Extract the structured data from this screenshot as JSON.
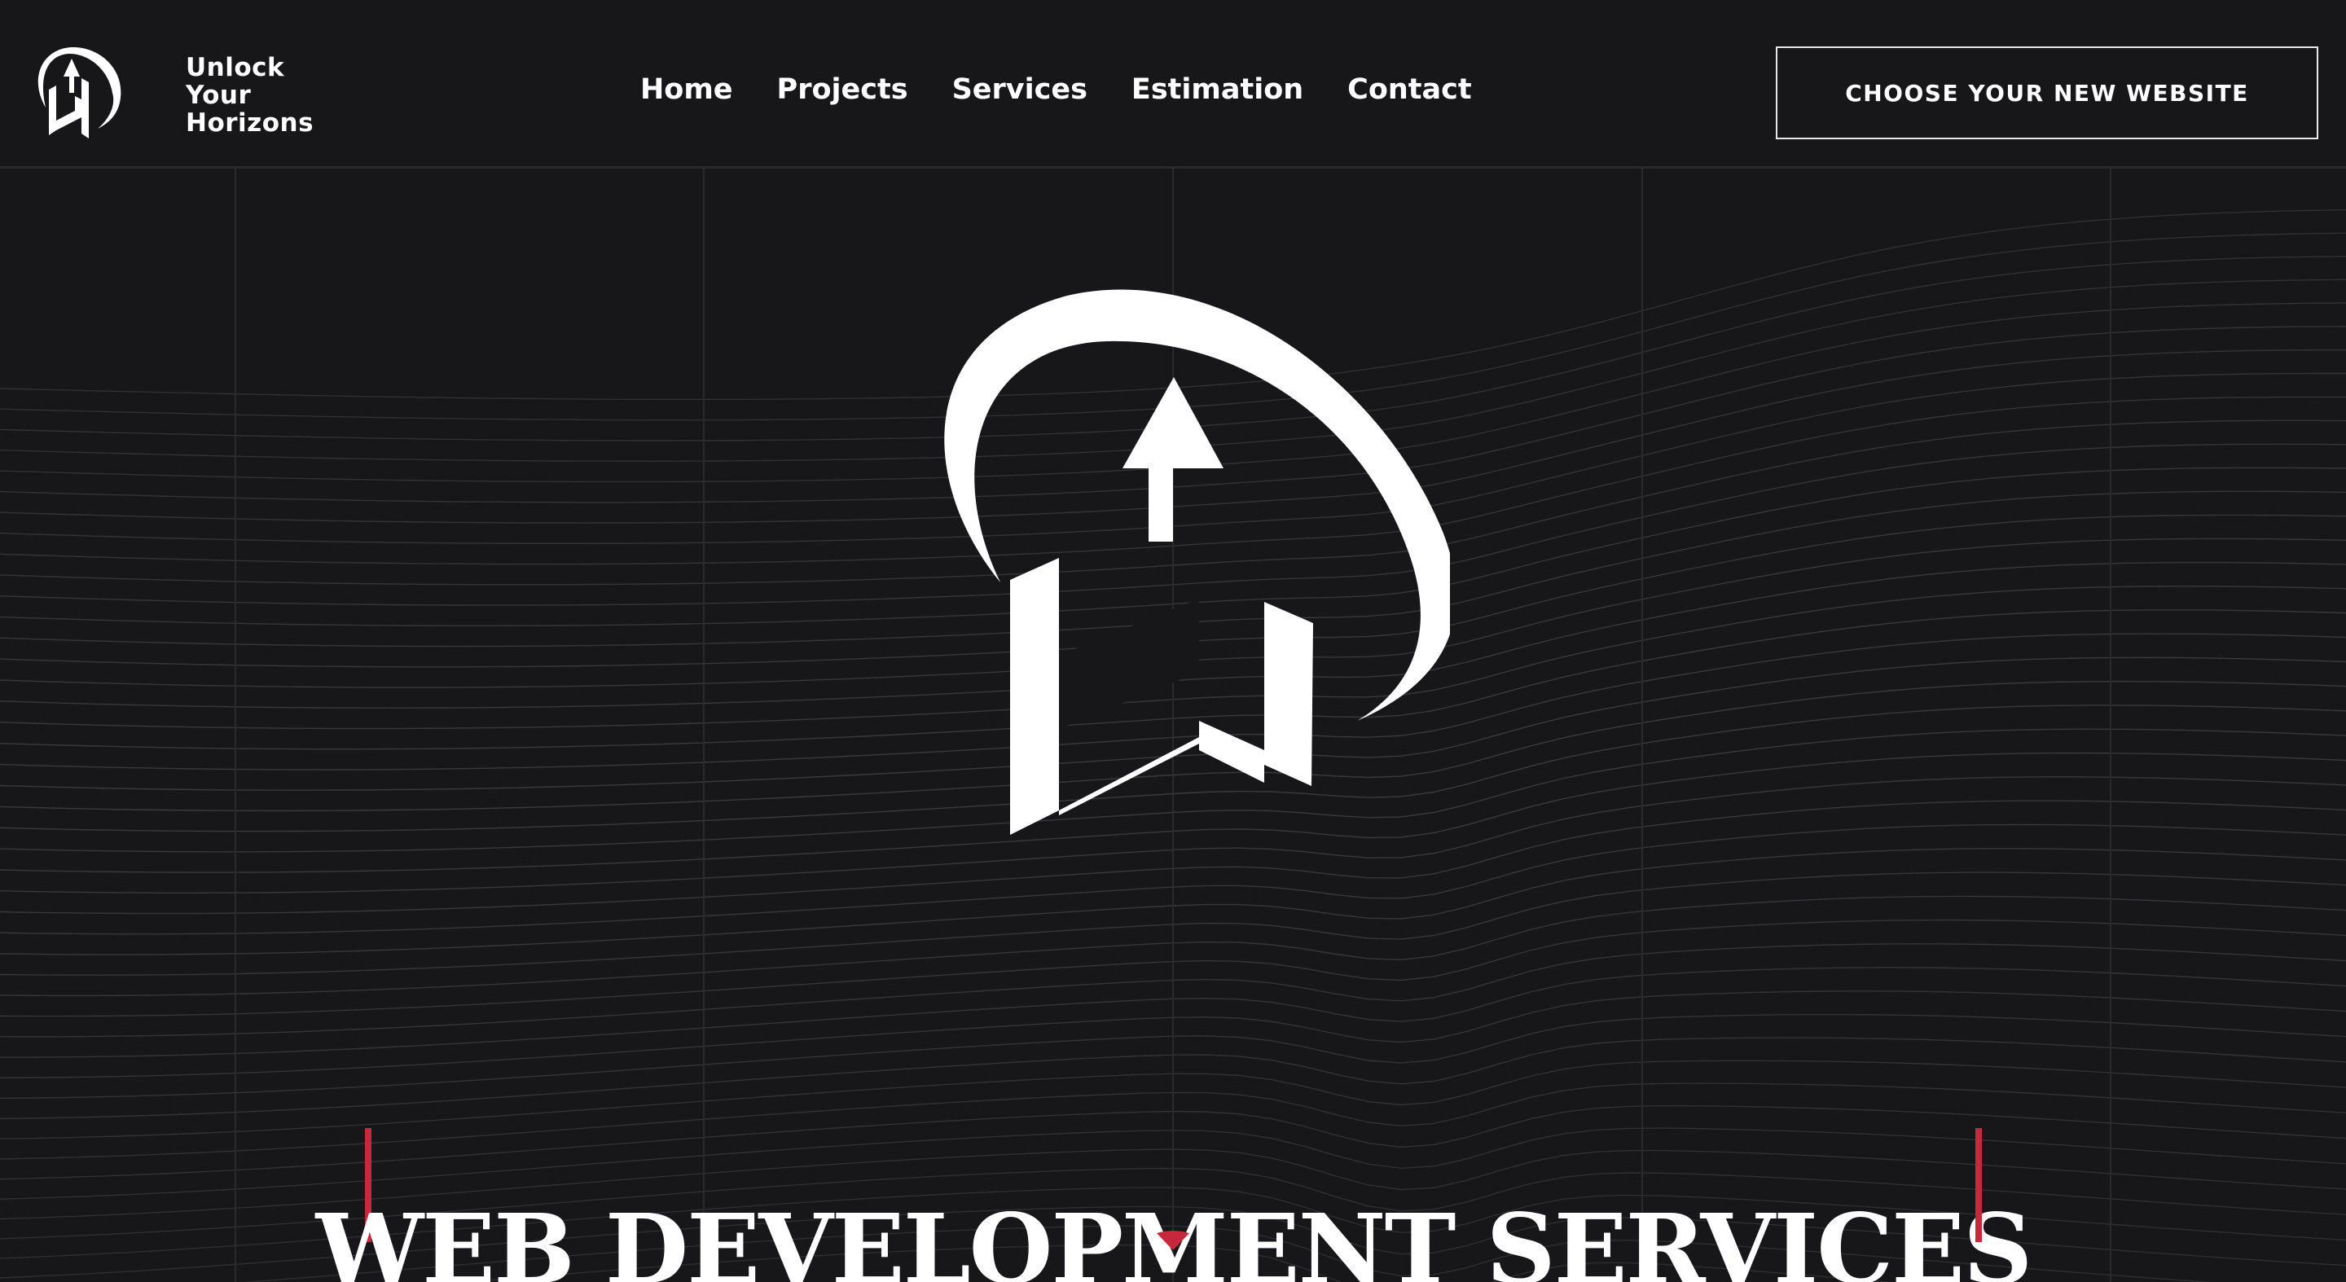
{
  "brand": {
    "line1": "Unlock",
    "line2": "Your",
    "line3": "Horizons"
  },
  "nav": [
    {
      "label": "Home"
    },
    {
      "label": "Projects"
    },
    {
      "label": "Services"
    },
    {
      "label": "Estimation"
    },
    {
      "label": "Contact"
    }
  ],
  "cta": {
    "label": "CHOOSE YOUR NEW WEBSITE"
  },
  "hero": {
    "title": "WEB DEVELOPMENT SERVICES"
  },
  "icons": {
    "brand": "uh-logo-icon",
    "hero": "uh-logo-icon",
    "scroll": "chevron-down-icon"
  },
  "colors": {
    "background": "#17171a",
    "accent": "#c8283c",
    "text": "#ffffff"
  }
}
